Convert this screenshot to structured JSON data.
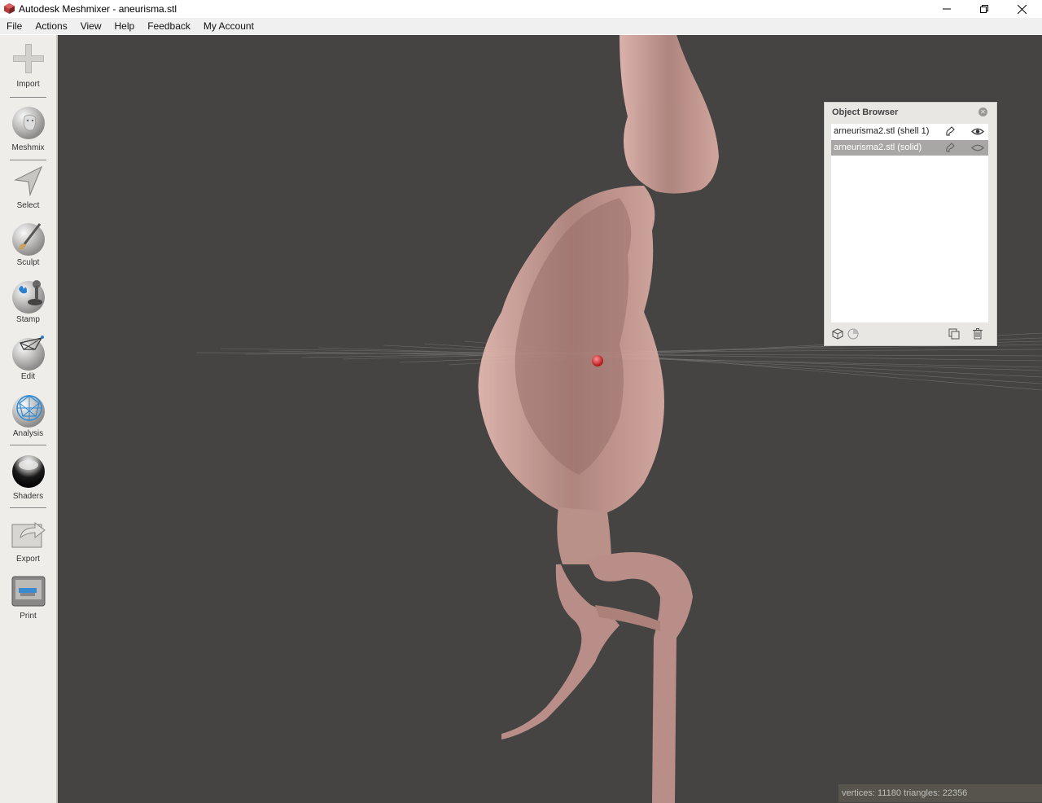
{
  "window": {
    "title": "Autodesk Meshmixer - aneurisma.stl"
  },
  "menu": [
    "File",
    "Actions",
    "View",
    "Help",
    "Feedback",
    "My Account"
  ],
  "toolbar": {
    "tools": [
      {
        "label": "Import",
        "icon": "plus-icon"
      },
      {
        "label": "Meshmix",
        "icon": "meshmix-head-icon"
      },
      {
        "label": "Select",
        "icon": "select-arrow-icon"
      },
      {
        "label": "Sculpt",
        "icon": "sculpt-brush-icon"
      },
      {
        "label": "Stamp",
        "icon": "stamp-icon"
      },
      {
        "label": "Edit",
        "icon": "edit-icon"
      },
      {
        "label": "Analysis",
        "icon": "analysis-icon"
      },
      {
        "label": "Shaders",
        "icon": "shader-sphere-icon"
      },
      {
        "label": "Export",
        "icon": "export-icon"
      },
      {
        "label": "Print",
        "icon": "printer-icon"
      }
    ]
  },
  "object_browser": {
    "title": "Object Browser",
    "items": [
      {
        "name": "arneurisma2.stl (shell 1)",
        "selected": false,
        "visible": true
      },
      {
        "name": "arneurisma2.stl (solid)",
        "selected": true,
        "visible": true
      }
    ]
  },
  "status": {
    "text": "vertices: 11180 triangles: 22356"
  },
  "colors": {
    "viewport_bg": "#464442",
    "mesh": "#d4a49c",
    "accent_marker": "#d23a3a"
  }
}
